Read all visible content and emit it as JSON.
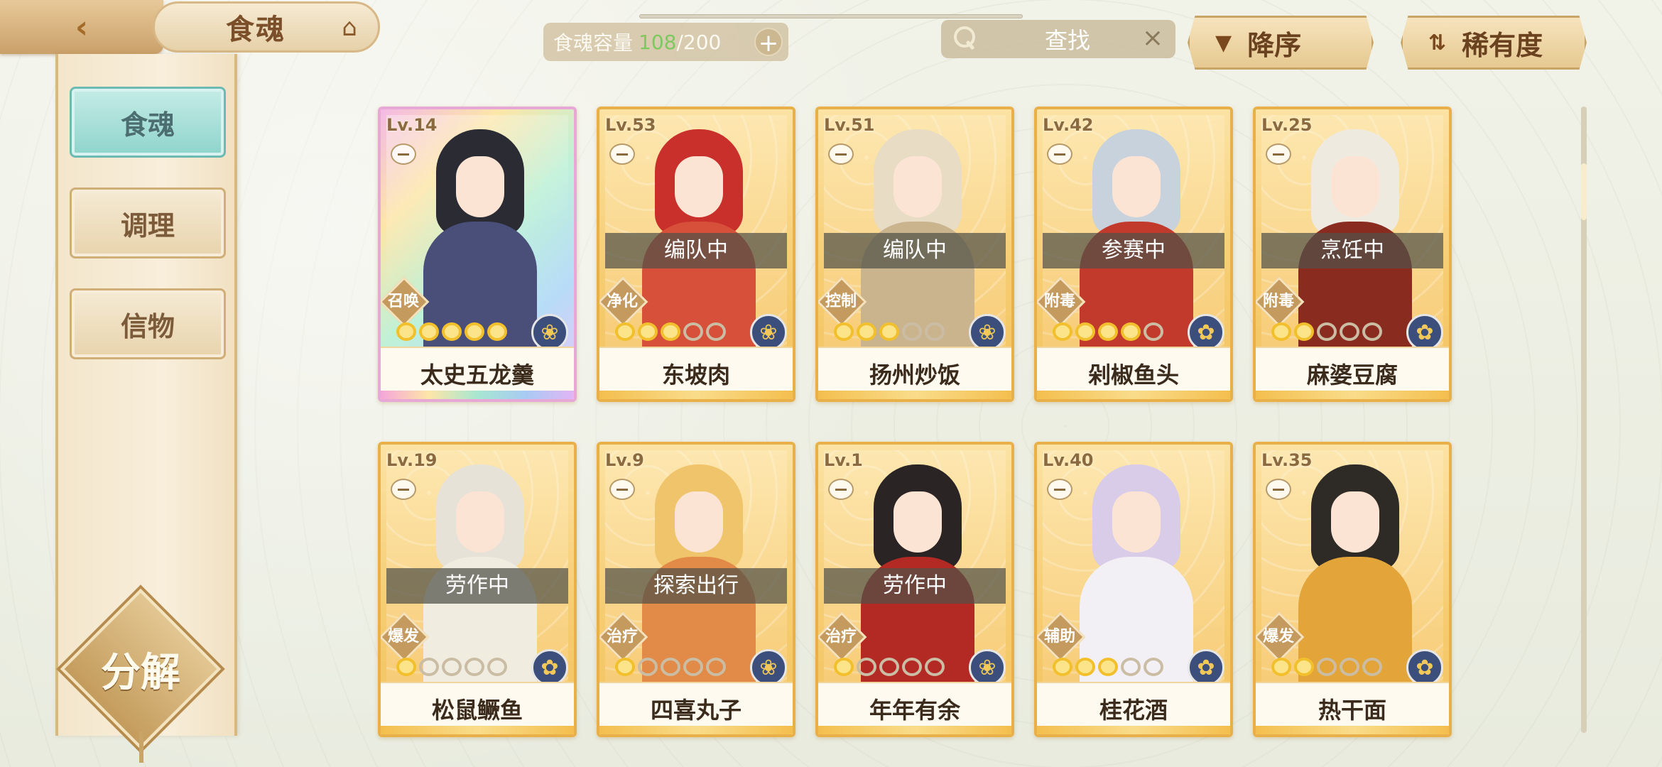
{
  "header": {
    "back_icon": "chevron-left-icon",
    "title": "食魂",
    "home_icon": "pavilion-icon",
    "capacity_label": "食魂容量",
    "capacity_used": "108",
    "capacity_sep": "/",
    "capacity_total": "200",
    "capacity_plus": "+",
    "search_placeholder": "查找",
    "search_clear": "×",
    "sort_order_label": "降序",
    "sort_order_icon": "▼",
    "sort_key_label": "稀有度",
    "sort_key_icon": "⇅"
  },
  "sidebar": {
    "tabs": [
      {
        "label": "食魂",
        "active": true
      },
      {
        "label": "调理",
        "active": false
      },
      {
        "label": "信物",
        "active": false
      }
    ],
    "decompose_label": "分解"
  },
  "cards": [
    {
      "level": "Lv.14",
      "name": "太史五龙羹",
      "status": "",
      "role": "召唤",
      "stars": 5,
      "stars_on": 5,
      "rarity": "rainbow",
      "hair": "#2b2b33",
      "body": "#4a4f7a",
      "element": "flower-icon"
    },
    {
      "level": "Lv.53",
      "name": "东坡肉",
      "status": "编队中",
      "role": "净化",
      "stars": 5,
      "stars_on": 3,
      "rarity": "gold",
      "hair": "#c9302c",
      "body": "#d6503a",
      "element": "flower-icon"
    },
    {
      "level": "Lv.51",
      "name": "扬州炒饭",
      "status": "编队中",
      "role": "控制",
      "stars": 5,
      "stars_on": 3,
      "rarity": "gold",
      "hair": "#e8dcc4",
      "body": "#c9b48e",
      "element": "flower-icon"
    },
    {
      "level": "Lv.42",
      "name": "剁椒鱼头",
      "status": "参赛中",
      "role": "附毒",
      "stars": 5,
      "stars_on": 4,
      "rarity": "gold",
      "hair": "#c8d2dc",
      "body": "#c23a2c",
      "element": "leaf-icon"
    },
    {
      "level": "Lv.25",
      "name": "麻婆豆腐",
      "status": "烹饪中",
      "role": "附毒",
      "stars": 5,
      "stars_on": 2,
      "rarity": "gold",
      "hair": "#efeae0",
      "body": "#8a2b20",
      "element": "leaf-icon"
    },
    {
      "level": "Lv.19",
      "name": "松鼠鳜鱼",
      "status": "劳作中",
      "role": "爆发",
      "stars": 5,
      "stars_on": 1,
      "rarity": "gold",
      "hair": "#e6e2d8",
      "body": "#f0ece0",
      "element": "leaf-icon"
    },
    {
      "level": "Lv.9",
      "name": "四喜丸子",
      "status": "探索出行",
      "role": "治疗",
      "stars": 5,
      "stars_on": 1,
      "rarity": "gold",
      "hair": "#f0c46a",
      "body": "#e28a48",
      "element": "flower-icon"
    },
    {
      "level": "Lv.1",
      "name": "年年有余",
      "status": "劳作中",
      "role": "治疗",
      "stars": 5,
      "stars_on": 1,
      "rarity": "gold",
      "hair": "#2a2424",
      "body": "#b32a24",
      "element": "flower-icon"
    },
    {
      "level": "Lv.40",
      "name": "桂花酒",
      "status": "",
      "role": "辅助",
      "stars": 5,
      "stars_on": 3,
      "rarity": "gold",
      "hair": "#d9cce8",
      "body": "#f2f0f4",
      "element": "leaf-icon"
    },
    {
      "level": "Lv.35",
      "name": "热干面",
      "status": "",
      "role": "爆发",
      "stars": 5,
      "stars_on": 2,
      "rarity": "gold",
      "hair": "#2e2a26",
      "body": "#e3a43a",
      "element": "leaf-icon"
    }
  ]
}
